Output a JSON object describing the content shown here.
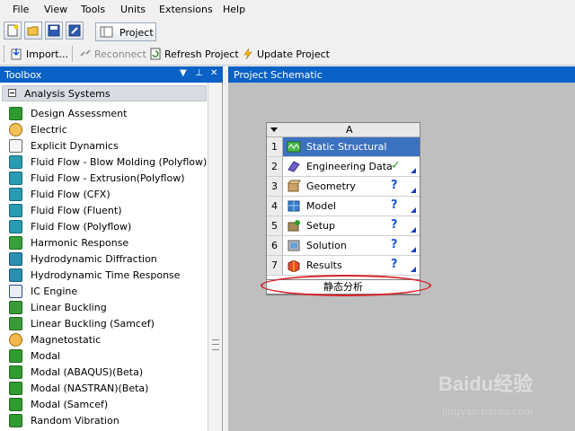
{
  "menu": [
    "File",
    "View",
    "Tools",
    "Units",
    "Extensions",
    "Help"
  ],
  "tabs": {
    "project": "Project"
  },
  "toolbar": {
    "import": "Import...",
    "reconnect": "Reconnect",
    "refresh": "Refresh Project",
    "update": "Update Project"
  },
  "toolbox": {
    "title": "Toolbox",
    "group": "Analysis Systems",
    "items": [
      {
        "label": "Design Assessment",
        "icon": "check-green"
      },
      {
        "label": "Electric",
        "icon": "electric"
      },
      {
        "label": "Explicit Dynamics",
        "icon": "explicit"
      },
      {
        "label": "Fluid Flow - Blow Molding (Polyflow)",
        "icon": "fluid"
      },
      {
        "label": "Fluid Flow - Extrusion(Polyflow)",
        "icon": "fluid"
      },
      {
        "label": "Fluid Flow (CFX)",
        "icon": "fluid"
      },
      {
        "label": "Fluid Flow (Fluent)",
        "icon": "fluid"
      },
      {
        "label": "Fluid Flow (Polyflow)",
        "icon": "fluid"
      },
      {
        "label": "Harmonic Response",
        "icon": "harmonic"
      },
      {
        "label": "Hydrodynamic Diffraction",
        "icon": "hydro"
      },
      {
        "label": "Hydrodynamic Time Response",
        "icon": "hydro"
      },
      {
        "label": "IC Engine",
        "icon": "ic-engine"
      },
      {
        "label": "Linear Buckling",
        "icon": "buckling"
      },
      {
        "label": "Linear Buckling (Samcef)",
        "icon": "buckling"
      },
      {
        "label": "Magnetostatic",
        "icon": "magneto"
      },
      {
        "label": "Modal",
        "icon": "modal"
      },
      {
        "label": "Modal (ABAQUS)(Beta)",
        "icon": "modal"
      },
      {
        "label": "Modal (NASTRAN)(Beta)",
        "icon": "modal"
      },
      {
        "label": "Modal (Samcef)",
        "icon": "modal"
      },
      {
        "label": "Random Vibration",
        "icon": "modal"
      }
    ]
  },
  "schematic": {
    "title": "Project Schematic",
    "column": "A",
    "rows": [
      {
        "num": "1",
        "label": "Static Structural",
        "status": ""
      },
      {
        "num": "2",
        "label": "Engineering Data",
        "status": "✓"
      },
      {
        "num": "3",
        "label": "Geometry",
        "status": "?"
      },
      {
        "num": "4",
        "label": "Model",
        "status": "?"
      },
      {
        "num": "5",
        "label": "Setup",
        "status": "?"
      },
      {
        "num": "6",
        "label": "Solution",
        "status": "?"
      },
      {
        "num": "7",
        "label": "Results",
        "status": "?"
      }
    ],
    "system_name": "静态分析"
  },
  "watermark": {
    "logo": "Baidu经验",
    "url": "jingyan.baidu.com"
  },
  "colors": {
    "header_blue": "#0b62c6",
    "title_row": "#3d72c0",
    "highlight_ellipse": "#d9232a",
    "status_green": "#3a9a2a",
    "status_blue": "#1a56d6"
  }
}
